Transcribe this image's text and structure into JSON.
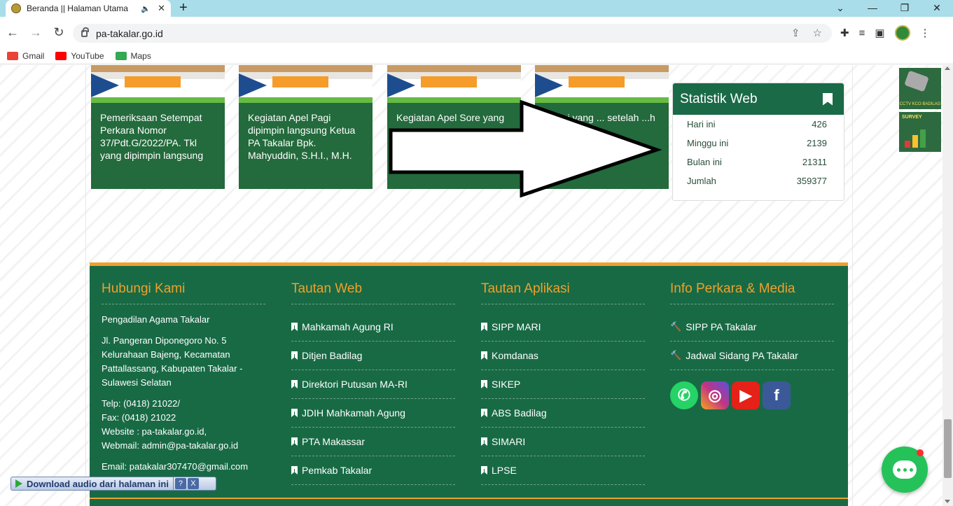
{
  "browser": {
    "tab_title": "Beranda || Halaman Utama",
    "url": "pa-takalar.go.id",
    "bookmarks": [
      {
        "label": "Gmail",
        "color": "#ea4335"
      },
      {
        "label": "YouTube",
        "color": "#ff0000"
      },
      {
        "label": "Maps",
        "color": "#34a853"
      }
    ]
  },
  "cards": [
    {
      "title": "Pemeriksaan Setempat Perkara Nomor 37/Pdt.G/2022/PA. Tkl yang dipimpin langsung"
    },
    {
      "title": "Kegiatan Apel Pagi dipimpin langsung Ketua PA Takalar Bpk. Mahyuddin, S.H.I., M.H."
    },
    {
      "title": "Kegiatan Apel Sore yang"
    },
    {
      "title": "...kusi yang ... setelah ...h"
    }
  ],
  "stats": {
    "title": "Statistik Web",
    "rows": [
      {
        "label": "Hari ini",
        "value": "426"
      },
      {
        "label": "Minggu ini",
        "value": "2139"
      },
      {
        "label": "Bulan ini",
        "value": "21311"
      },
      {
        "label": "Jumlah",
        "value": "359377"
      }
    ]
  },
  "side_banners": {
    "cctv": "CCTV KCO BADILAG",
    "survey": "SURVEY"
  },
  "footer": {
    "contact": {
      "heading": "Hubungi Kami",
      "name": "Pengadilan Agama Takalar",
      "address": "Jl. Pangeran Diponegoro No. 5 Kelurahaan Bajeng, Kecamatan Pattallassang, Kabupaten Takalar - Sulawesi Selatan",
      "phone": "Telp: (0418) 21022/",
      "fax": "Fax: (0418) 21022",
      "website": "Website : pa-takalar.go.id,",
      "webmail": "Webmail: admin@pa-takalar.go.id",
      "email": "Email: patakalar307470@gmail.com"
    },
    "tautan_web": {
      "heading": "Tautan Web",
      "links": [
        "Mahkamah Agung RI",
        "Ditjen Badilag",
        "Direktori Putusan MA-RI",
        "JDIH Mahkamah Agung",
        "PTA Makassar",
        "Pemkab Takalar"
      ]
    },
    "tautan_aplikasi": {
      "heading": "Tautan Aplikasi",
      "links": [
        "SIPP MARI",
        "Komdanas",
        "SIKEP",
        "ABS Badilag",
        "SIMARI",
        "LPSE"
      ]
    },
    "info_perkara": {
      "heading": "Info Perkara & Media",
      "links": [
        "SIPP PA Takalar",
        "Jadwal Sidang PA Takalar"
      ],
      "social": [
        {
          "name": "whatsapp-icon",
          "color": "#25d366"
        },
        {
          "name": "instagram-icon",
          "color": "#c13584"
        },
        {
          "name": "youtube-icon",
          "color": "#e62117"
        },
        {
          "name": "facebook-icon",
          "color": "#3b5998"
        }
      ]
    }
  },
  "download_bar": {
    "label": "Download audio dari halaman ini",
    "help": "?",
    "close": "X"
  }
}
